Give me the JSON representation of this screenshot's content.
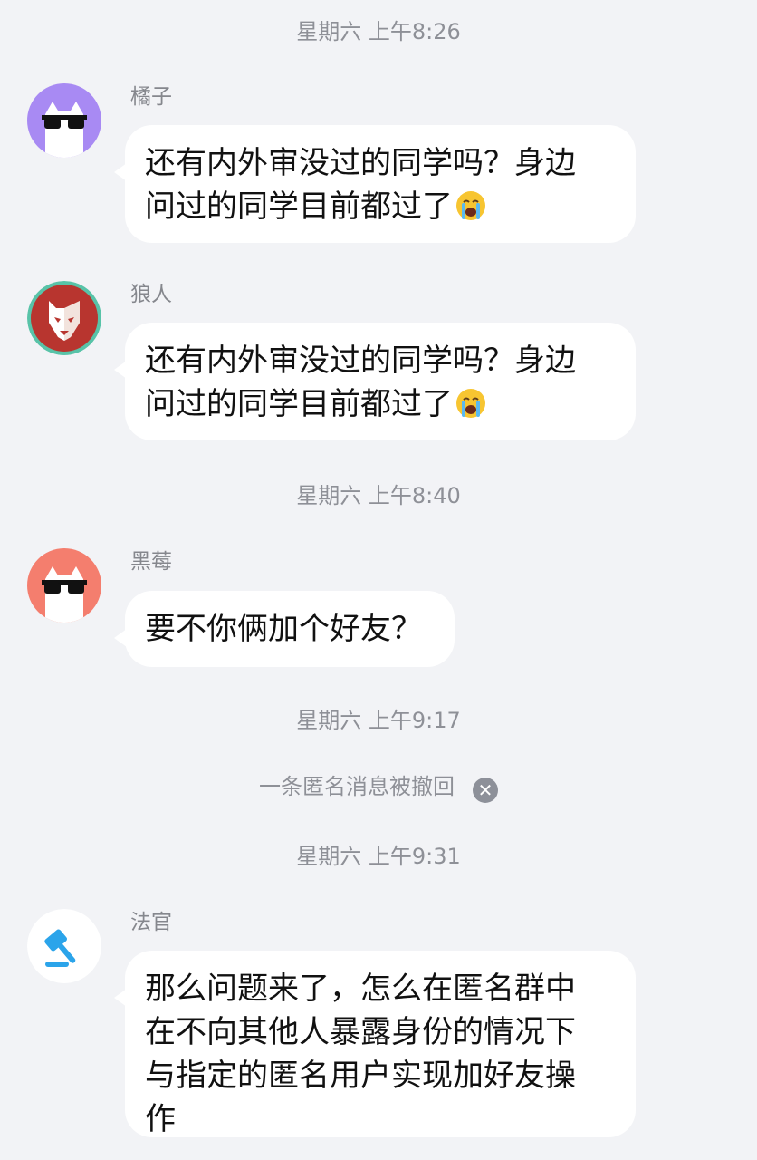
{
  "timestamps": {
    "t1": "星期六 上午8:26",
    "t2": "星期六 上午8:40",
    "t3": "星期六 上午9:17",
    "t4": "星期六 上午9:31"
  },
  "messages": [
    {
      "sender": "橘子",
      "avatar_icon": "cat-sunglasses-icon",
      "avatar_color": "#a88af3",
      "lines": [
        "还有内外审没过的同学吗？身边",
        "问过的同学目前都过了"
      ],
      "emoji": "crying-face-emoji"
    },
    {
      "sender": "狼人",
      "avatar_icon": "wolf-icon",
      "avatar_color": "#b8352f",
      "lines": [
        "还有内外审没过的同学吗？身边",
        "问过的同学目前都过了"
      ],
      "emoji": "crying-face-emoji"
    },
    {
      "sender": "黑莓",
      "avatar_icon": "cat-sunglasses-icon",
      "avatar_color": "#f47e6e",
      "lines": [
        "要不你俩加个好友？"
      ]
    },
    {
      "sender": "法官",
      "avatar_icon": "gavel-icon",
      "avatar_color": "#ffffff",
      "lines": [
        "那么问题来了，怎么在匿名群中",
        "在不向其他人暴露身份的情况下",
        "与指定的匿名用户实现加好友操",
        "作"
      ]
    }
  ],
  "system": {
    "recall_text": "一条匿名消息被撤回",
    "recall_icon": "close-circle-icon"
  },
  "colors": {
    "background": "#f2f3f6",
    "bubble": "#ffffff",
    "gavel_blue": "#2ba4ea"
  }
}
